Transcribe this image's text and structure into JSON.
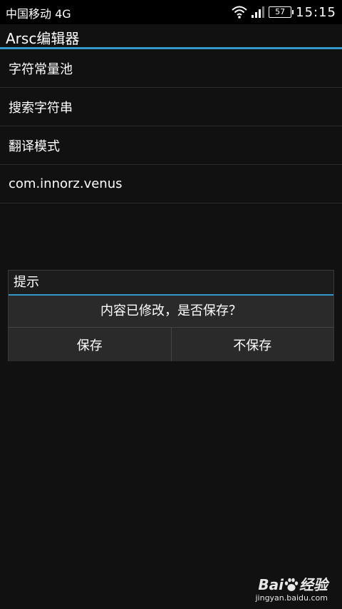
{
  "status_bar": {
    "carrier": "中国移动 4G",
    "battery": "57",
    "time": "15:15",
    "icons": [
      "wifi-icon",
      "signal-icon",
      "battery-icon"
    ]
  },
  "action_bar": {
    "title": "Arsc编辑器",
    "accent_color": "#3399cc"
  },
  "menu": {
    "items": [
      {
        "label": "字符常量池"
      },
      {
        "label": "搜索字符串"
      },
      {
        "label": "翻译模式"
      },
      {
        "label": "com.innorz.venus"
      }
    ]
  },
  "dialog": {
    "title": "提示",
    "message": "内容已修改，是否保存？",
    "buttons": [
      {
        "label": "保存"
      },
      {
        "label": "不保存"
      }
    ]
  },
  "watermark": {
    "logo_text_left": "Bai",
    "logo_text_right": "经验",
    "url": "jingyan.baidu.com",
    "icon": "paw-icon"
  },
  "colors": {
    "background": "#111111",
    "accent": "#3399cc",
    "dialog_background": "#2a2a2a"
  }
}
